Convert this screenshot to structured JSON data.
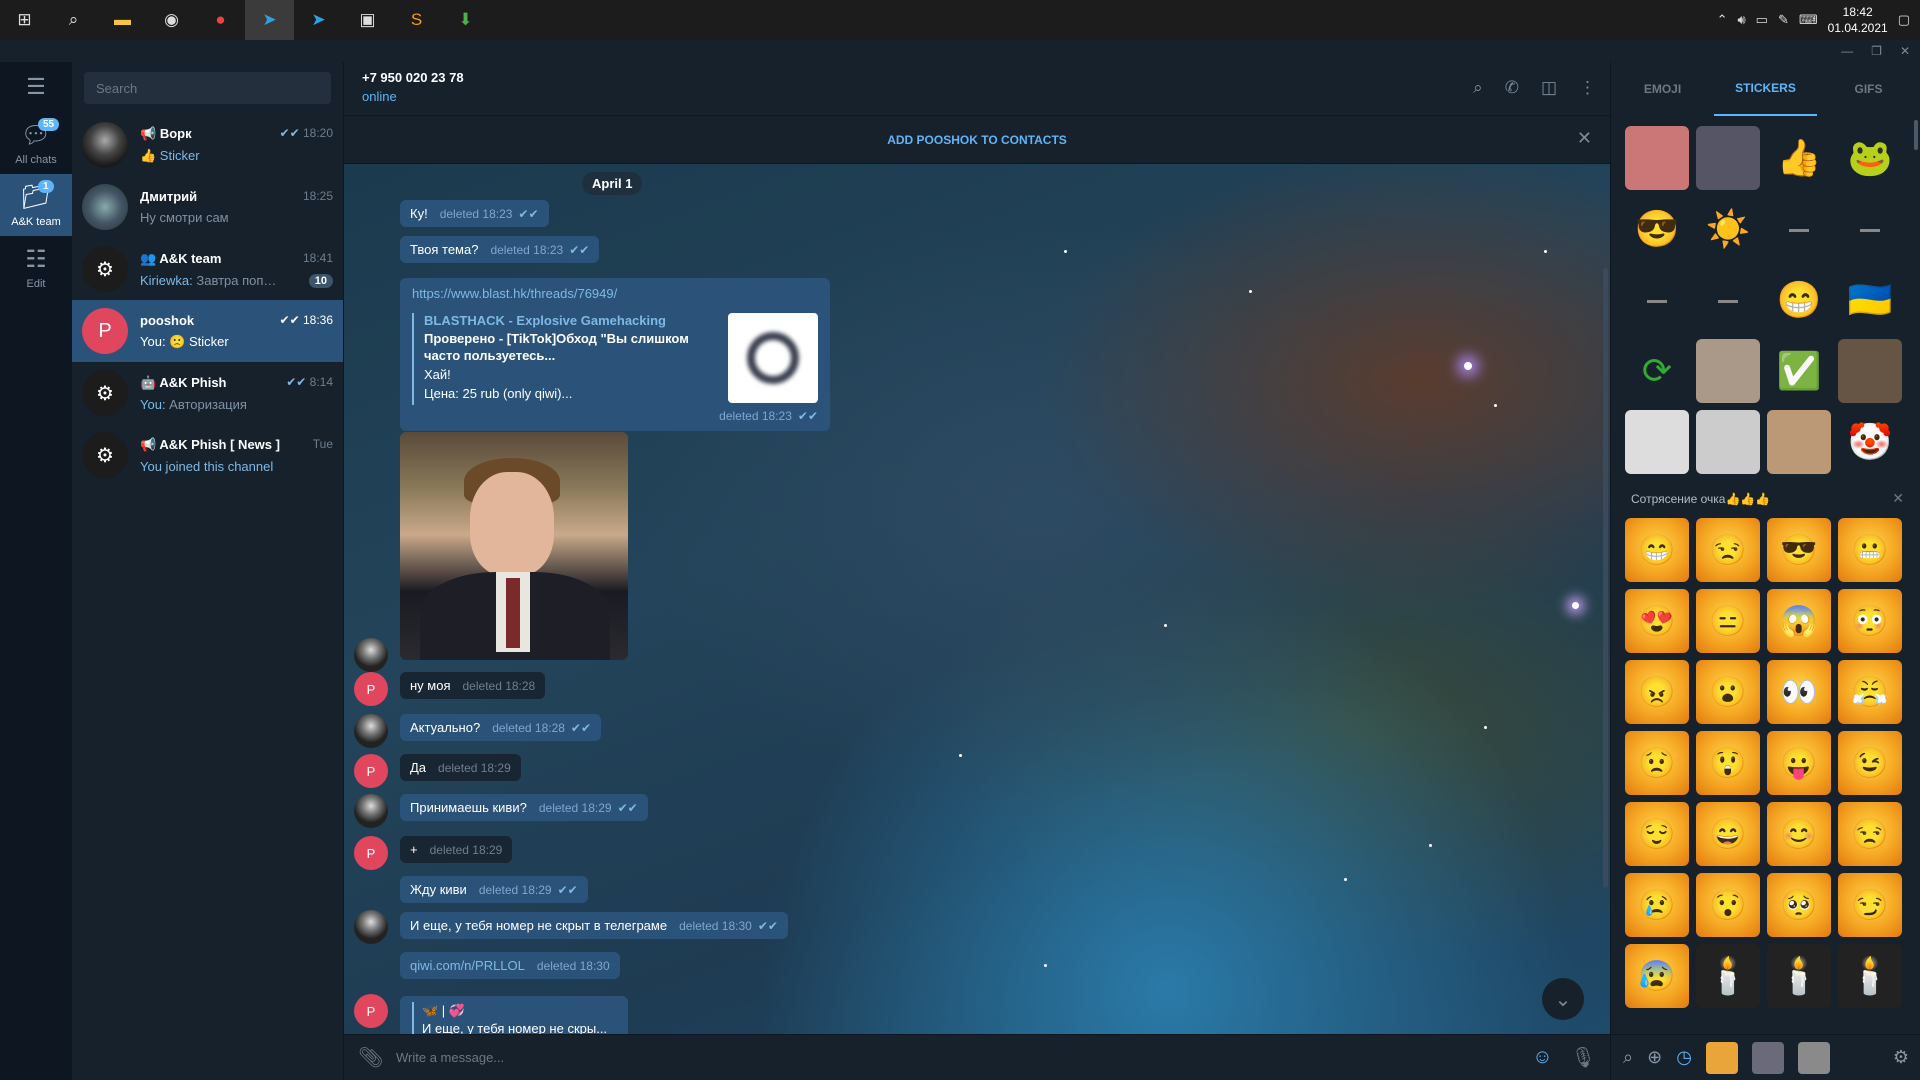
{
  "taskbar": {
    "time": "18:42",
    "date": "01.04.2021"
  },
  "folders": {
    "all_chats": {
      "label": "All chats",
      "badge": "55"
    },
    "team": {
      "label": "A&K team",
      "badge": "1"
    },
    "edit": {
      "label": "Edit"
    }
  },
  "search": {
    "placeholder": "Search"
  },
  "dialogs": [
    {
      "name": "Ворк",
      "time": "18:20",
      "prefix": "",
      "msg": "👍 Sticker",
      "avatar_color": "#3d3d3d"
    },
    {
      "name": "Дмитрий",
      "time": "18:25",
      "prefix": "",
      "msg": "Ну смотри сам",
      "avatar_color": "#5a7a8a"
    },
    {
      "name": "A&K team",
      "time": "18:41",
      "prefix": "Kiriewka:",
      "msg": " Завтра попроб...",
      "unread": "10",
      "avatar_color": "#1c1c1c"
    },
    {
      "name": "pooshok",
      "time": "18:36",
      "prefix": "",
      "msg": "You: 🙁 Sticker",
      "avatar_letter": "P",
      "avatar_color": "#e0465d"
    },
    {
      "name": "A&K Phish",
      "time": "8:14",
      "prefix": "You:",
      "msg": " Авторизация",
      "avatar_color": "#1c1c1c"
    },
    {
      "name": "A&K Phish [ News ]",
      "time": "Tue",
      "prefix": "",
      "msg": "You joined this channel",
      "avatar_color": "#1c1c1c"
    }
  ],
  "chat": {
    "title": "+7 950 020 23 78",
    "status": "online",
    "add_contact": "ADD POOSHOK TO CONTACTS",
    "date": "April 1",
    "messages": [
      {
        "text": "Ку!",
        "meta": "deleted 18:23"
      },
      {
        "text": "Твоя тема?",
        "meta": "deleted 18:23"
      },
      {
        "text": "ну моя",
        "meta": "deleted 18:28"
      },
      {
        "text": "Актуально?",
        "meta": "deleted 18:28"
      },
      {
        "text": "Да",
        "meta": "deleted 18:29"
      },
      {
        "text": "Принимаешь киви?",
        "meta": "deleted 18:29"
      },
      {
        "text": "+",
        "meta": "deleted 18:29"
      },
      {
        "text": "Жду киви",
        "meta": "deleted 18:29"
      },
      {
        "text": "И еще, у тебя номер не скрыт в телеграме",
        "meta": "deleted 18:30"
      },
      {
        "text": "qiwi.com/n/PRLLOL",
        "meta": "deleted 18:30"
      }
    ],
    "link": {
      "url": "https://www.blast.hk/threads/76949/",
      "site": "BLASTHACK - Explosive Gamehacking",
      "title": "Проверено - [TikTok]Обход \"Вы слишком часто пользуетесь...",
      "line1": "Хай!",
      "line2": "Цена: 25 rub (only qiwi)...",
      "meta": "deleted 18:23"
    },
    "reply": {
      "top": "🦋 | 💞",
      "text": "И еще, у тебя номер не скры..."
    },
    "avatar_letter": "P",
    "compose_placeholder": "Write a message..."
  },
  "stickers": {
    "tabs": [
      "EMOJI",
      "STICKERS",
      "GIFS"
    ],
    "set_title": "Сотрясение очка👍👍👍"
  }
}
